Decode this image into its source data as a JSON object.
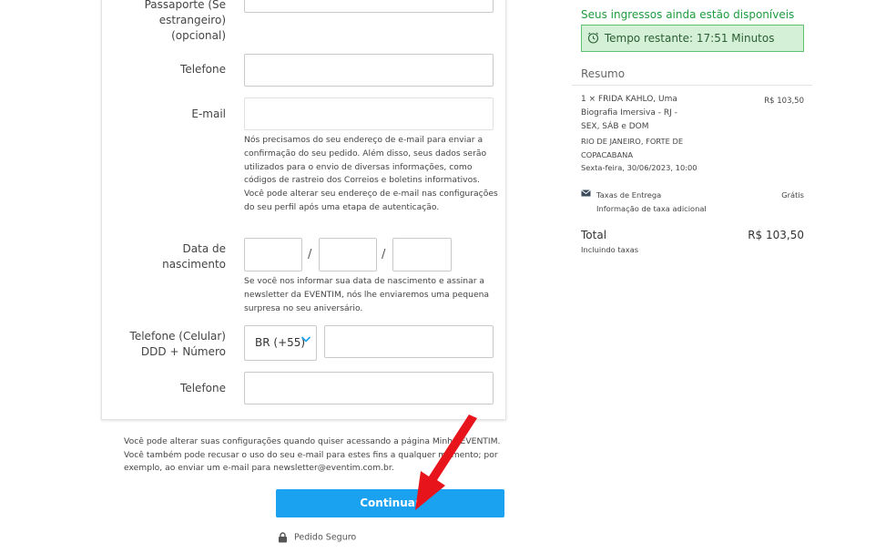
{
  "form": {
    "passport_label": [
      "Passaporte (Se",
      "estrangeiro)",
      "(opcional)"
    ],
    "telefone_label": "Telefone",
    "email_label": "E-mail",
    "email_help": "Nós precisamos do seu endereço de e-mail para enviar a confirmação do seu pedido. Além disso, seus dados serão utilizados para o envio de diversas informações, como códigos de rastreio dos Correios e boletins informativos. Você pode alterar seu endereço de e-mail nas configurações do seu perfil após uma etapa de autenticação.",
    "birth_label": [
      "Data de",
      "nascimento"
    ],
    "date_separator": "/",
    "birth_help": "Se você nos informar sua data de nascimento e assinar a newsletter da EVENTIM, nós lhe enviaremos uma pequena surpresa no seu aniversário.",
    "mobile_label": [
      "Telefone (Celular)",
      "DDD + Número"
    ],
    "country_code": "BR (+55)",
    "telefone2_label": "Telefone"
  },
  "footer": {
    "notice": "Você pode alterar suas configurações quando quiser acessando a página Minha EVENTIM. Você também pode recusar o uso do seu e-mail para estes fins a qualquer momento; por exemplo, ao enviar um e-mail para newsletter@eventim.com.br.",
    "continue_label": "Continuar",
    "secure_label": "Pedido Seguro"
  },
  "sidebar": {
    "availability": "Seus ingressos ainda estão disponíveis",
    "timer": "Tempo restante: 17:51 Minutos",
    "summary_title": "Resumo",
    "item_title": [
      "1 × FRIDA KAHLO, Uma",
      "Biografia Imersiva - RJ -",
      "SEX, SÁB e DOM"
    ],
    "item_price": "R$ 103,50",
    "item_venue": [
      "RIO DE JANEIRO, FORTE DE",
      "COPACABANA"
    ],
    "item_date": "Sexta-feira, 30/06/2023, 10:00",
    "delivery_label": "Taxas de Entrega",
    "delivery_value": "Grátis",
    "delivery_info": "Informação de taxa adicional",
    "total_label": "Total",
    "total_value": "R$ 103,50",
    "total_note": "Incluindo taxas"
  },
  "colors": {
    "accent": "#1aa1f0",
    "success_text": "#1e9c3e",
    "timer_bg": "#d4f1d7",
    "timer_border": "#5cc270",
    "annotation_arrow": "#e8141b"
  },
  "icons": [
    "clock-icon",
    "envelope-icon",
    "chevron-down-icon",
    "lock-icon",
    "red-arrow-annotation"
  ]
}
